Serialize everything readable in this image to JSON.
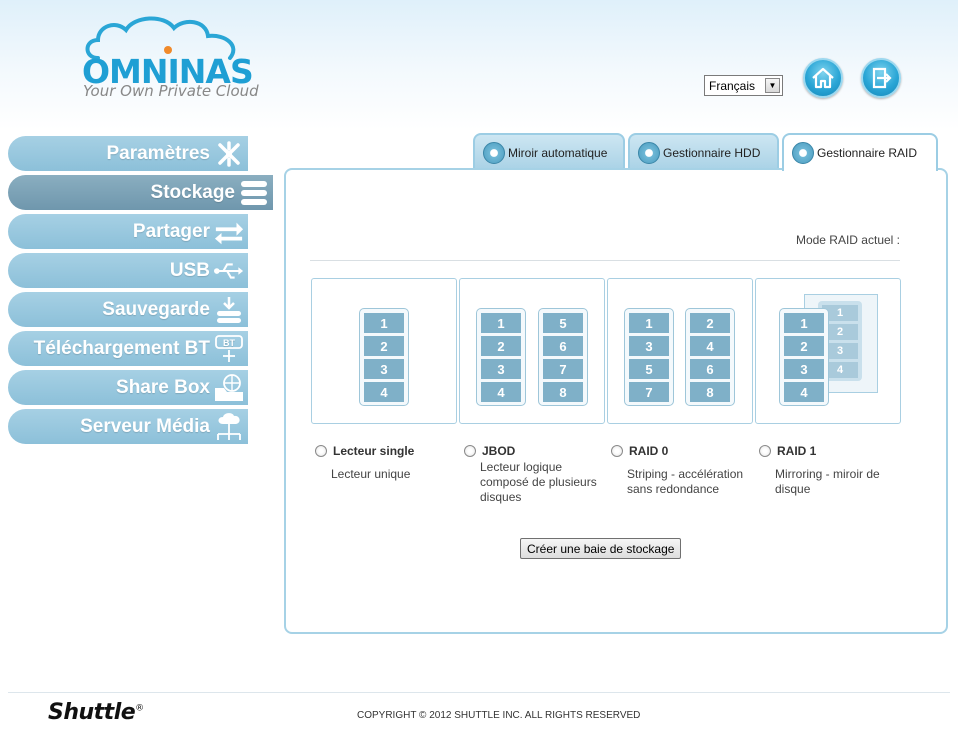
{
  "brand": {
    "logo_text": "OMNINAS",
    "tagline": "Your Own Private Cloud",
    "colors": {
      "primary": "#1f9fd4",
      "nav": "#9cc8de",
      "nav_active": "#7ea3b7",
      "panel_border": "#a6d2e6"
    }
  },
  "header": {
    "language": "Français",
    "home_icon": "home-icon",
    "logout_icon": "logout-icon"
  },
  "sidebar": {
    "items": [
      {
        "label": "Paramètres",
        "icon": "tools-icon",
        "active": false
      },
      {
        "label": "Stockage",
        "icon": "storage-icon",
        "active": true
      },
      {
        "label": "Partager",
        "icon": "share-arrows-icon",
        "active": false
      },
      {
        "label": "USB",
        "icon": "usb-icon",
        "active": false
      },
      {
        "label": "Sauvegarde",
        "icon": "backup-icon",
        "active": false
      },
      {
        "label": "Téléchargement BT",
        "icon": "bt-download-icon",
        "active": false
      },
      {
        "label": "Share Box",
        "icon": "share-box-icon",
        "active": false
      },
      {
        "label": "Serveur Média",
        "icon": "media-server-icon",
        "active": false
      }
    ]
  },
  "tabs": [
    {
      "label": "Miroir automatique",
      "active": false
    },
    {
      "label": "Gestionnaire HDD",
      "active": false
    },
    {
      "label": "Gestionnaire RAID",
      "active": true
    }
  ],
  "raid": {
    "current_mode_label": "Mode RAID actuel :",
    "options": [
      {
        "title": "Lecteur single",
        "description": "Lecteur unique",
        "disks": [
          [
            "1",
            "2",
            "3",
            "4"
          ]
        ]
      },
      {
        "title": "JBOD",
        "description": "Lecteur logique composé de plusieurs disques",
        "disks": [
          [
            "1",
            "2",
            "3",
            "4"
          ],
          [
            "5",
            "6",
            "7",
            "8"
          ]
        ]
      },
      {
        "title": "RAID 0",
        "description": "Striping - accélération sans redondance",
        "disks": [
          [
            "1",
            "3",
            "5",
            "7"
          ],
          [
            "2",
            "4",
            "6",
            "8"
          ]
        ]
      },
      {
        "title": "RAID 1",
        "description": "Mirroring - miroir de disque",
        "disks": [
          [
            "1",
            "2",
            "3",
            "4"
          ]
        ],
        "mirror": [
          "1",
          "2",
          "3",
          "4"
        ]
      }
    ],
    "create_button": "Créer une baie de stockage"
  },
  "footer": {
    "brand": "Shuttle",
    "copyright": "COPYRIGHT © 2012 SHUTTLE INC. ALL RIGHTS RESERVED"
  }
}
